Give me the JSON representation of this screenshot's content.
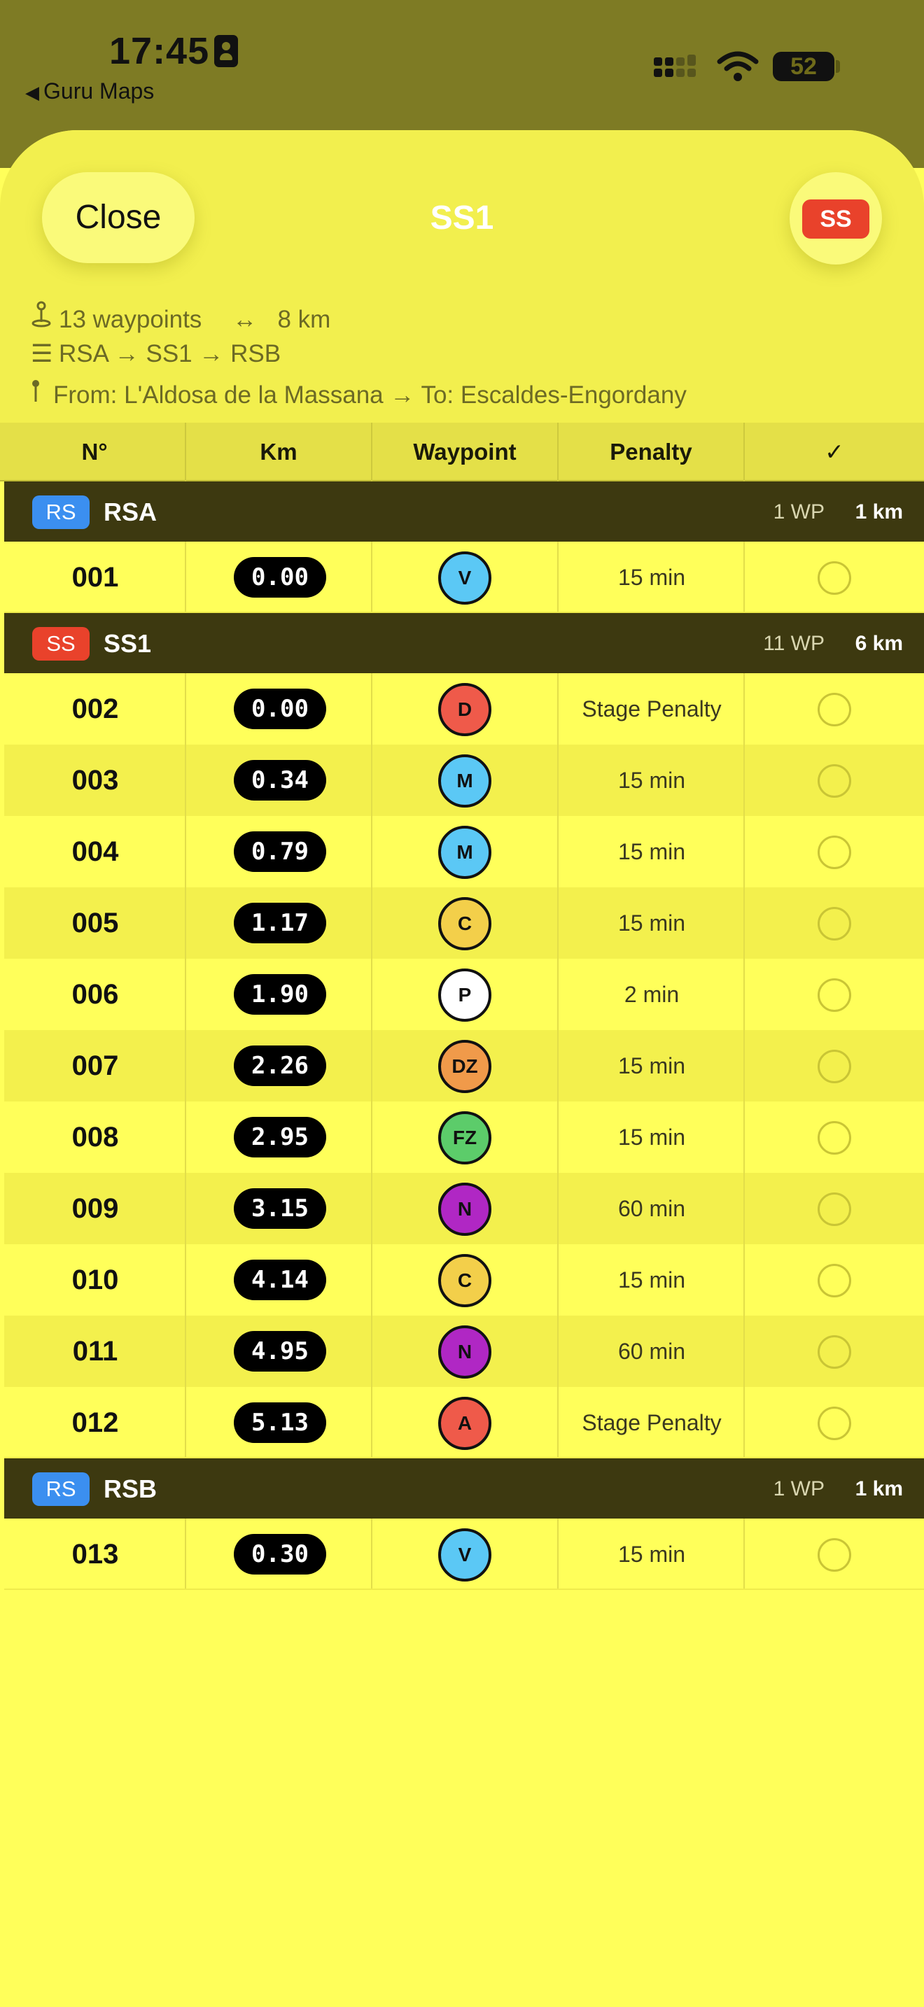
{
  "status_bar": {
    "time": "17:45",
    "back_app": "Guru Maps",
    "battery": "52"
  },
  "sheet": {
    "close_label": "Close",
    "title": "SS1",
    "type_badge": "SS",
    "waypoints_info": "13 waypoints",
    "distance_info": "8 km",
    "route_info": "RSA → SS1 → RSB",
    "from_to_info": "From: L'Aldosa de la Massana  →  To: Escaldes-Engordany"
  },
  "table": {
    "headers": [
      "N°",
      "Km",
      "Waypoint",
      "Penalty",
      "✓"
    ]
  },
  "groups": [
    {
      "chip": "RS",
      "chip_color": "#3b8ff0",
      "name": "RSA",
      "wp": "1 WP",
      "km": "1 km",
      "rows": [
        {
          "n": "001",
          "km": "0.00",
          "wp": "V",
          "wp_color": "#5bc8f5",
          "penalty": "15 min"
        }
      ]
    },
    {
      "chip": "SS",
      "chip_color": "#e9422b",
      "name": "SS1",
      "wp": "11 WP",
      "km": "6 km",
      "rows": [
        {
          "n": "002",
          "km": "0.00",
          "wp": "D",
          "wp_color": "#ef5a4a",
          "penalty": "Stage Penalty"
        },
        {
          "n": "003",
          "km": "0.34",
          "wp": "M",
          "wp_color": "#5bc8f5",
          "penalty": "15 min"
        },
        {
          "n": "004",
          "km": "0.79",
          "wp": "M",
          "wp_color": "#5bc8f5",
          "penalty": "15 min"
        },
        {
          "n": "005",
          "km": "1.17",
          "wp": "C",
          "wp_color": "#f3cf4a",
          "penalty": "15 min"
        },
        {
          "n": "006",
          "km": "1.90",
          "wp": "P",
          "wp_color": "#ffffff",
          "penalty": "2 min"
        },
        {
          "n": "007",
          "km": "2.26",
          "wp": "DZ",
          "wp_color": "#f09a4a",
          "penalty": "15 min"
        },
        {
          "n": "008",
          "km": "2.95",
          "wp": "FZ",
          "wp_color": "#5ccc6a",
          "penalty": "15 min"
        },
        {
          "n": "009",
          "km": "3.15",
          "wp": "N",
          "wp_color": "#b027c4",
          "penalty": "60 min"
        },
        {
          "n": "010",
          "km": "4.14",
          "wp": "C",
          "wp_color": "#f3cf4a",
          "penalty": "15 min"
        },
        {
          "n": "011",
          "km": "4.95",
          "wp": "N",
          "wp_color": "#b027c4",
          "penalty": "60 min"
        },
        {
          "n": "012",
          "km": "5.13",
          "wp": "A",
          "wp_color": "#ef5a4a",
          "penalty": "Stage Penalty"
        }
      ]
    },
    {
      "chip": "RS",
      "chip_color": "#3b8ff0",
      "name": "RSB",
      "wp": "1 WP",
      "km": "1 km",
      "rows": [
        {
          "n": "013",
          "km": "0.30",
          "wp": "V",
          "wp_color": "#5bc8f5",
          "penalty": "15 min"
        }
      ]
    }
  ]
}
